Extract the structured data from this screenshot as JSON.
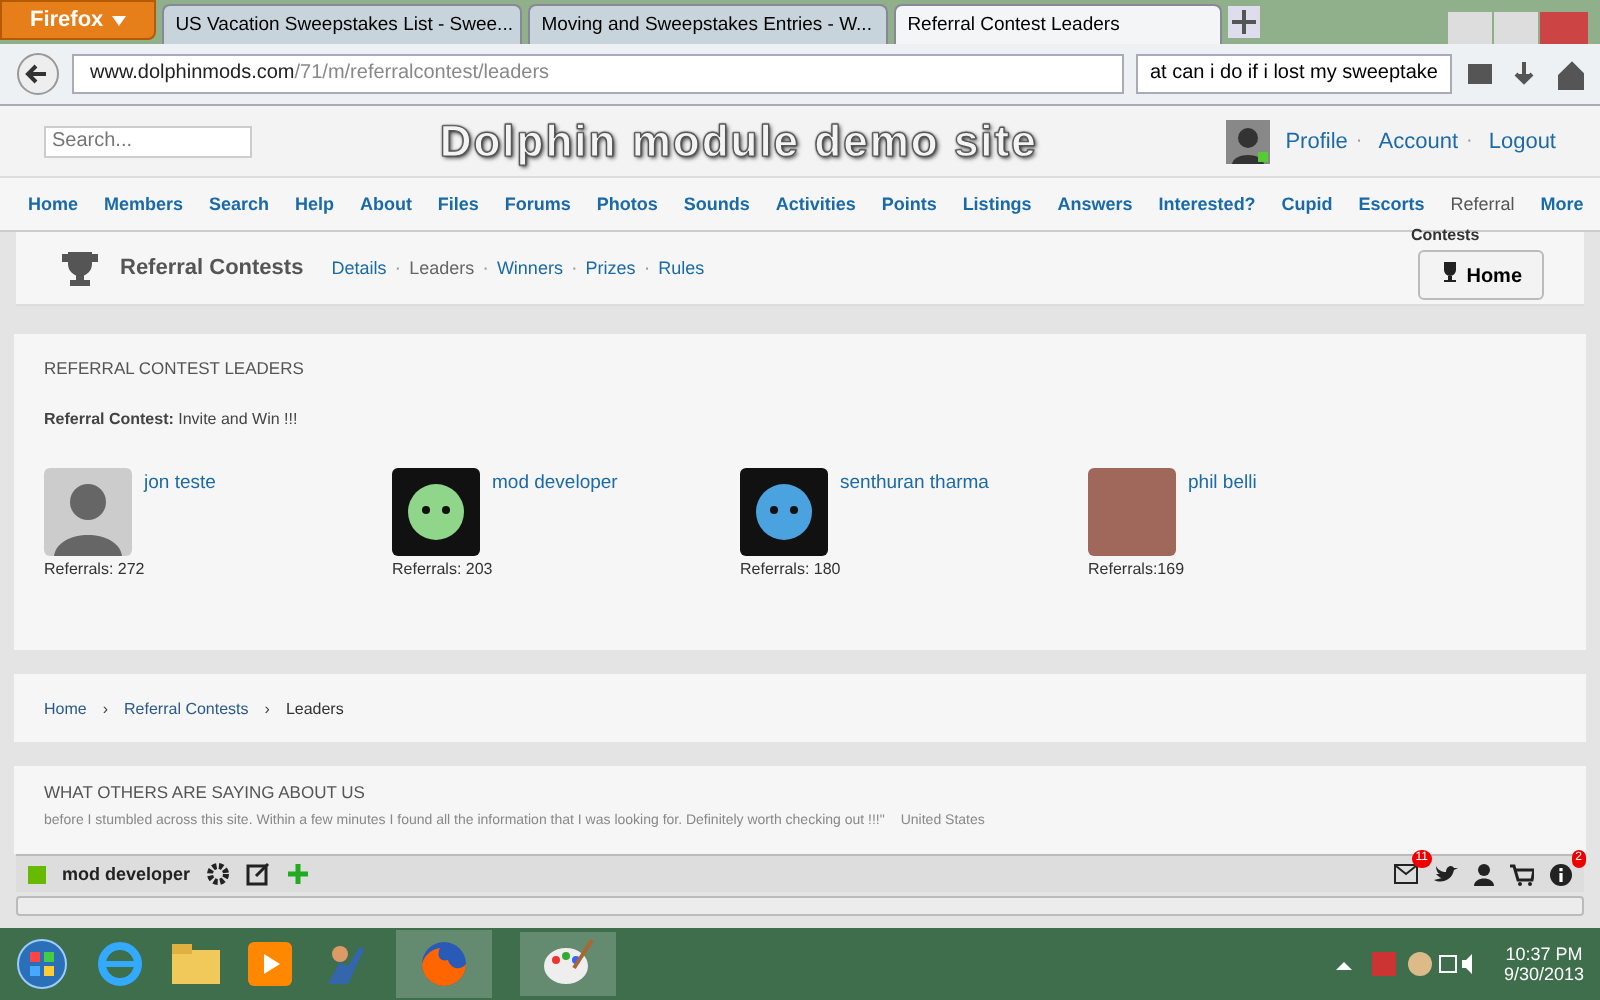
{
  "browser": {
    "menu_button": "Firefox",
    "tabs": [
      {
        "title": "US Vacation Sweepstakes List - Swee...",
        "selected": false
      },
      {
        "title": "Moving and Sweepstakes Entries - W...",
        "selected": false
      },
      {
        "title": "Referral Contest Leaders",
        "selected": true
      }
    ],
    "url_host": "www.dolphinmods.com",
    "url_path": "/71/m/referralcontest/leaders",
    "search_value": "at can i do if i lost my sweeptake"
  },
  "header": {
    "search_placeholder": "Search...",
    "site_title": "Dolphin module demo site",
    "user_links": [
      "Profile",
      "Account",
      "Logout"
    ],
    "separator": "·"
  },
  "nav": [
    {
      "label": "Home",
      "selected": false
    },
    {
      "label": "Members",
      "selected": false
    },
    {
      "label": "Search",
      "selected": false
    },
    {
      "label": "Help",
      "selected": false
    },
    {
      "label": "About",
      "selected": false
    },
    {
      "label": "Files",
      "selected": false
    },
    {
      "label": "Forums",
      "selected": false
    },
    {
      "label": "Photos",
      "selected": false
    },
    {
      "label": "Sounds",
      "selected": false
    },
    {
      "label": "Activities",
      "selected": false
    },
    {
      "label": "Points",
      "selected": false
    },
    {
      "label": "Listings",
      "selected": false
    },
    {
      "label": "Answers",
      "selected": false
    },
    {
      "label": "Interested?",
      "selected": false
    },
    {
      "label": "Cupid",
      "selected": false
    },
    {
      "label": "Escorts",
      "selected": false
    },
    {
      "label": "Referral",
      "selected": true
    },
    {
      "label": "More",
      "selected": false
    }
  ],
  "subheader": {
    "title": "Referral Contests",
    "links": [
      {
        "label": "Details",
        "selected": false
      },
      {
        "label": "Leaders",
        "selected": true
      },
      {
        "label": "Winners",
        "selected": false
      },
      {
        "label": "Prizes",
        "selected": false
      },
      {
        "label": "Rules",
        "selected": false
      }
    ],
    "separator": "·",
    "overflow_label": "Contests",
    "home_button": "Home"
  },
  "leaders": {
    "heading": "REFERRAL CONTEST LEADERS",
    "contest_label": "Referral Contest:",
    "contest_name": "Invite and Win !!!",
    "entries": [
      {
        "name": "jon teste",
        "referrals": "Referrals: 272",
        "kind": "silhouette"
      },
      {
        "name": "mod developer",
        "referrals": "Referrals: 203",
        "kind": "cartoon"
      },
      {
        "name": "senthuran tharma",
        "referrals": "Referrals: 180",
        "kind": "cartoon"
      },
      {
        "name": "phil belli",
        "referrals": "Referrals:169",
        "kind": "photo"
      }
    ]
  },
  "breadcrumb_separator": "›",
  "breadcrumb": [
    {
      "label": "Home",
      "kind": "link"
    },
    {
      "label": "Referral Contests",
      "kind": "link"
    },
    {
      "label": "Leaders",
      "kind": "current"
    }
  ],
  "testimonials": {
    "heading": "WHAT OTHERS ARE SAYING ABOUT US",
    "quote": "before I stumbled across this site. Within a few minutes I found all the information that I was looking for. Definitely worth checking out !!!\"",
    "location": "United States"
  },
  "toolbar": {
    "user": "mod developer",
    "mail_badge": "11",
    "info_badge": "2"
  },
  "taskbar": {
    "time": "10:37 PM",
    "date": "9/30/2013"
  }
}
